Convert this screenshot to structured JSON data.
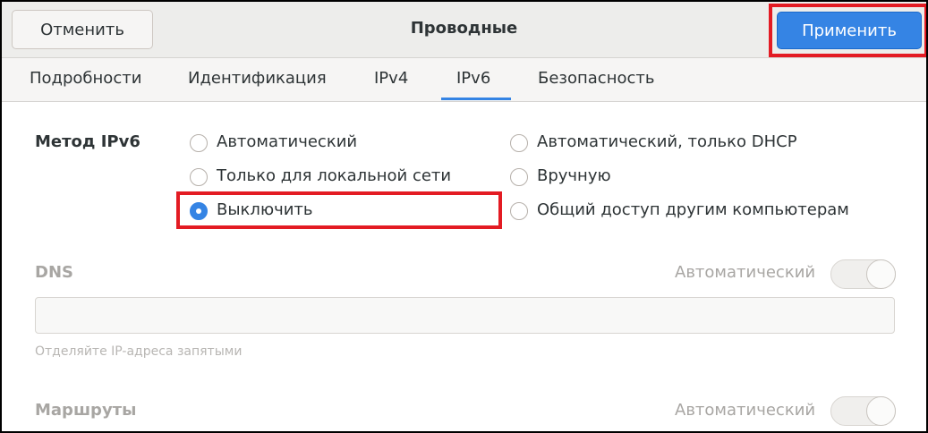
{
  "header": {
    "cancel_label": "Отменить",
    "title": "Проводные",
    "apply_label": "Применить"
  },
  "tabs": [
    {
      "label": "Подробности",
      "active": false
    },
    {
      "label": "Идентификация",
      "active": false
    },
    {
      "label": "IPv4",
      "active": false
    },
    {
      "label": "IPv6",
      "active": true
    },
    {
      "label": "Безопасность",
      "active": false
    }
  ],
  "ipv6_method": {
    "label": "Метод IPv6",
    "options": [
      {
        "label": "Автоматический",
        "checked": false
      },
      {
        "label": "Автоматический, только DHCP",
        "checked": false
      },
      {
        "label": "Только для локальной сети",
        "checked": false
      },
      {
        "label": "Вручную",
        "checked": false
      },
      {
        "label": "Выключить",
        "checked": true
      },
      {
        "label": "Общий доступ другим компьютерам",
        "checked": false
      }
    ]
  },
  "dns": {
    "label": "DNS",
    "auto_label": "Автоматический",
    "auto_enabled": true,
    "value": "",
    "hint": "Отделяйте IP-адреса запятыми"
  },
  "routes": {
    "label": "Маршруты",
    "auto_label": "Автоматический",
    "auto_enabled": true
  },
  "colors": {
    "accent": "#3584e4",
    "highlight": "#e31b23"
  }
}
